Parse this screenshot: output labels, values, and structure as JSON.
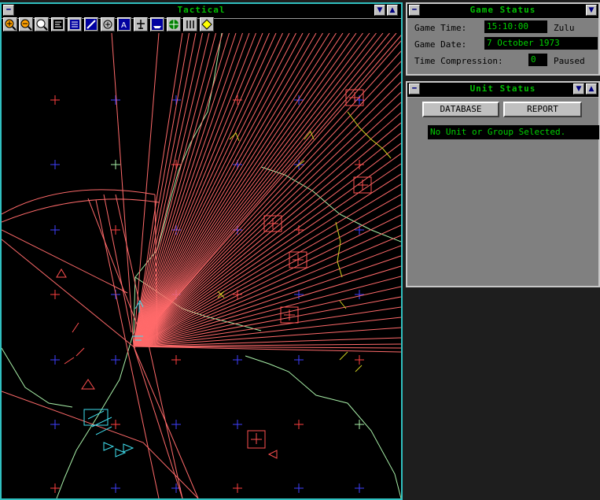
{
  "tactical": {
    "title": "Tactical",
    "toolbar": [
      "zoom-in-icon",
      "zoom-out-icon",
      "magnify-icon",
      "formation-icon",
      "group-icon",
      "range-ring-icon",
      "radar-icon",
      "altitude-icon",
      "aircraft-icon",
      "ship-icon",
      "target-icon",
      "missile-icon",
      "waypoint-icon"
    ]
  },
  "game_status": {
    "title": "Game Status",
    "time_label": "Game Time:",
    "time_value": "15:10:00",
    "time_zone": "Zulu",
    "date_label": "Game Date:",
    "date_value": "7 October 1973",
    "compression_label": "Time Compression:",
    "compression_value": "0",
    "paused": "Paused"
  },
  "unit_status": {
    "title": "Unit Status",
    "database_label": "DATABASE",
    "report_label": "REPORT",
    "message": "No Unit or Group Selected."
  },
  "colors": {
    "map_bg": "#000000",
    "coast": "#a8f0a8",
    "radar": "#ff6060",
    "friendly": "#40e0f0",
    "enemy": "#ff5050",
    "neutral": "#d0d020",
    "grid_blue": "#4040ff",
    "grid_red": "#ff4040"
  }
}
